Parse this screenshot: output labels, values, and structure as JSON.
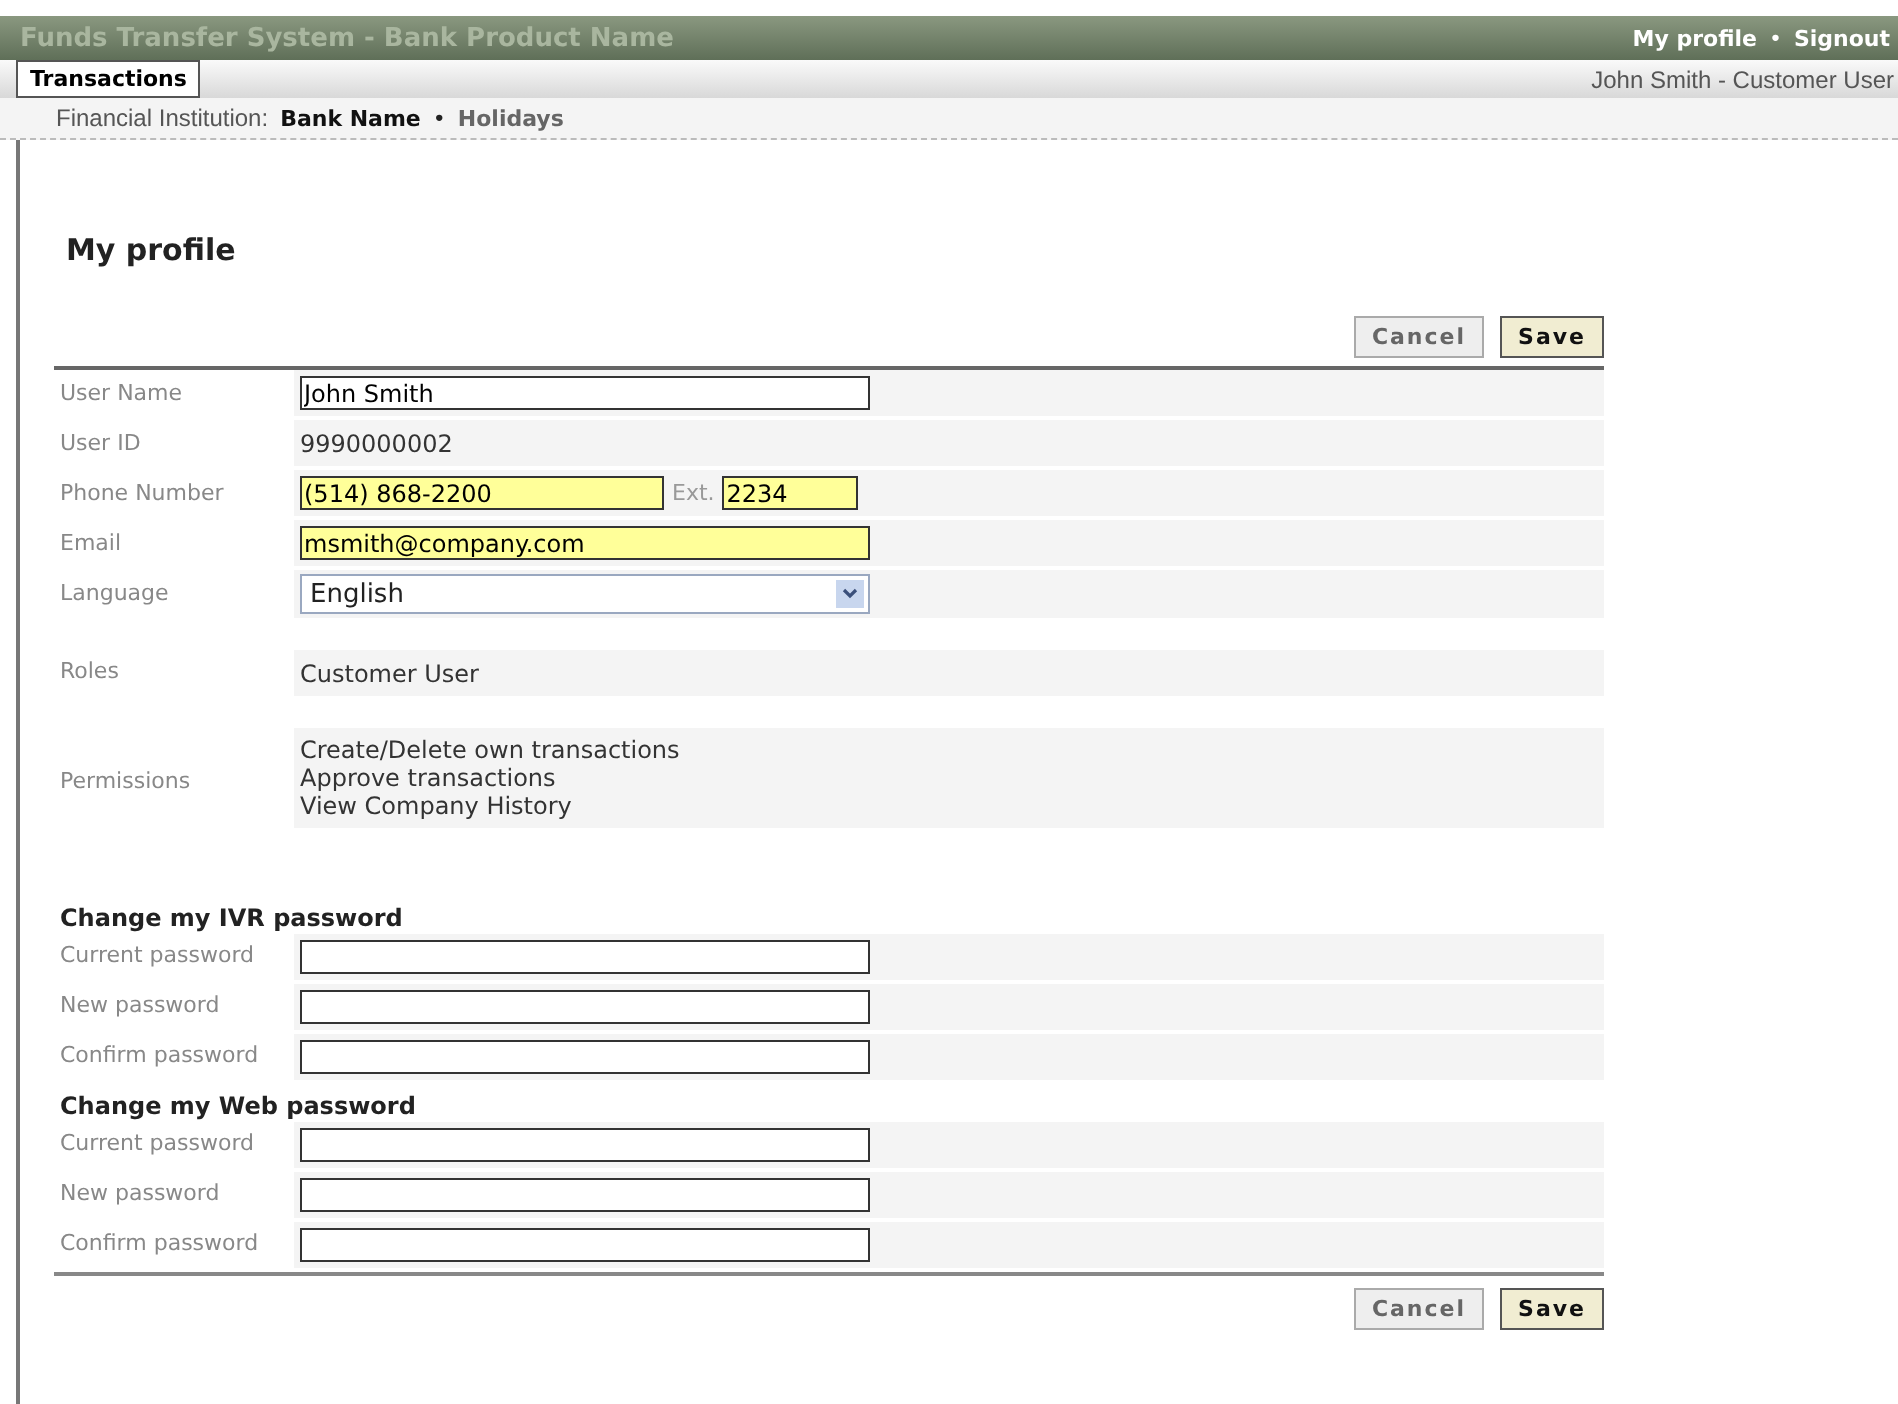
{
  "header": {
    "app_title": "Funds Transfer System  - Bank Product Name",
    "links": [
      "My profile",
      "Signout"
    ],
    "separator": "•"
  },
  "tabs": [
    {
      "label": "Transactions",
      "selected": true
    }
  ],
  "user_info": "John Smith - Customer User",
  "breadcrumb": {
    "label": "Financial Institution:",
    "items": [
      "Bank Name",
      "Holidays"
    ],
    "separator": "•"
  },
  "page_title": "My profile",
  "top_buttons": [
    {
      "label": "Cancel",
      "kind": "secondary"
    },
    {
      "label": "Save",
      "kind": "primary"
    }
  ],
  "bottom_buttons": [
    {
      "label": "Cancel",
      "kind": "secondary"
    },
    {
      "label": "Save",
      "kind": "primary"
    }
  ],
  "profile_rows": [
    {
      "label": "User Name",
      "kind": "input",
      "value": "John Smith",
      "highlighted": false
    },
    {
      "label": "User ID",
      "kind": "static",
      "value": "9990000002"
    },
    {
      "label": "Phone Number",
      "kind": "phone",
      "value": "(514) 868-2200",
      "ext_label": "Ext.",
      "ext_value": "2234",
      "highlighted": true
    },
    {
      "label": "Email",
      "kind": "input",
      "value": "msmith@company.com",
      "highlighted": true
    },
    {
      "label": "Language",
      "kind": "select",
      "value": "English"
    },
    {
      "label": "Roles",
      "kind": "static",
      "value": "Customer User"
    },
    {
      "label": "Permissions",
      "kind": "list",
      "values": [
        "Create/Delete own transactions",
        "Approve transactions",
        "View Company History"
      ]
    }
  ],
  "password_sections": [
    {
      "title": "Change my IVR password",
      "fields": [
        "Current password",
        "New password",
        "Confirm password"
      ]
    },
    {
      "title": "Change my Web password",
      "fields": [
        "Current password",
        "New password",
        "Confirm password"
      ]
    }
  ]
}
